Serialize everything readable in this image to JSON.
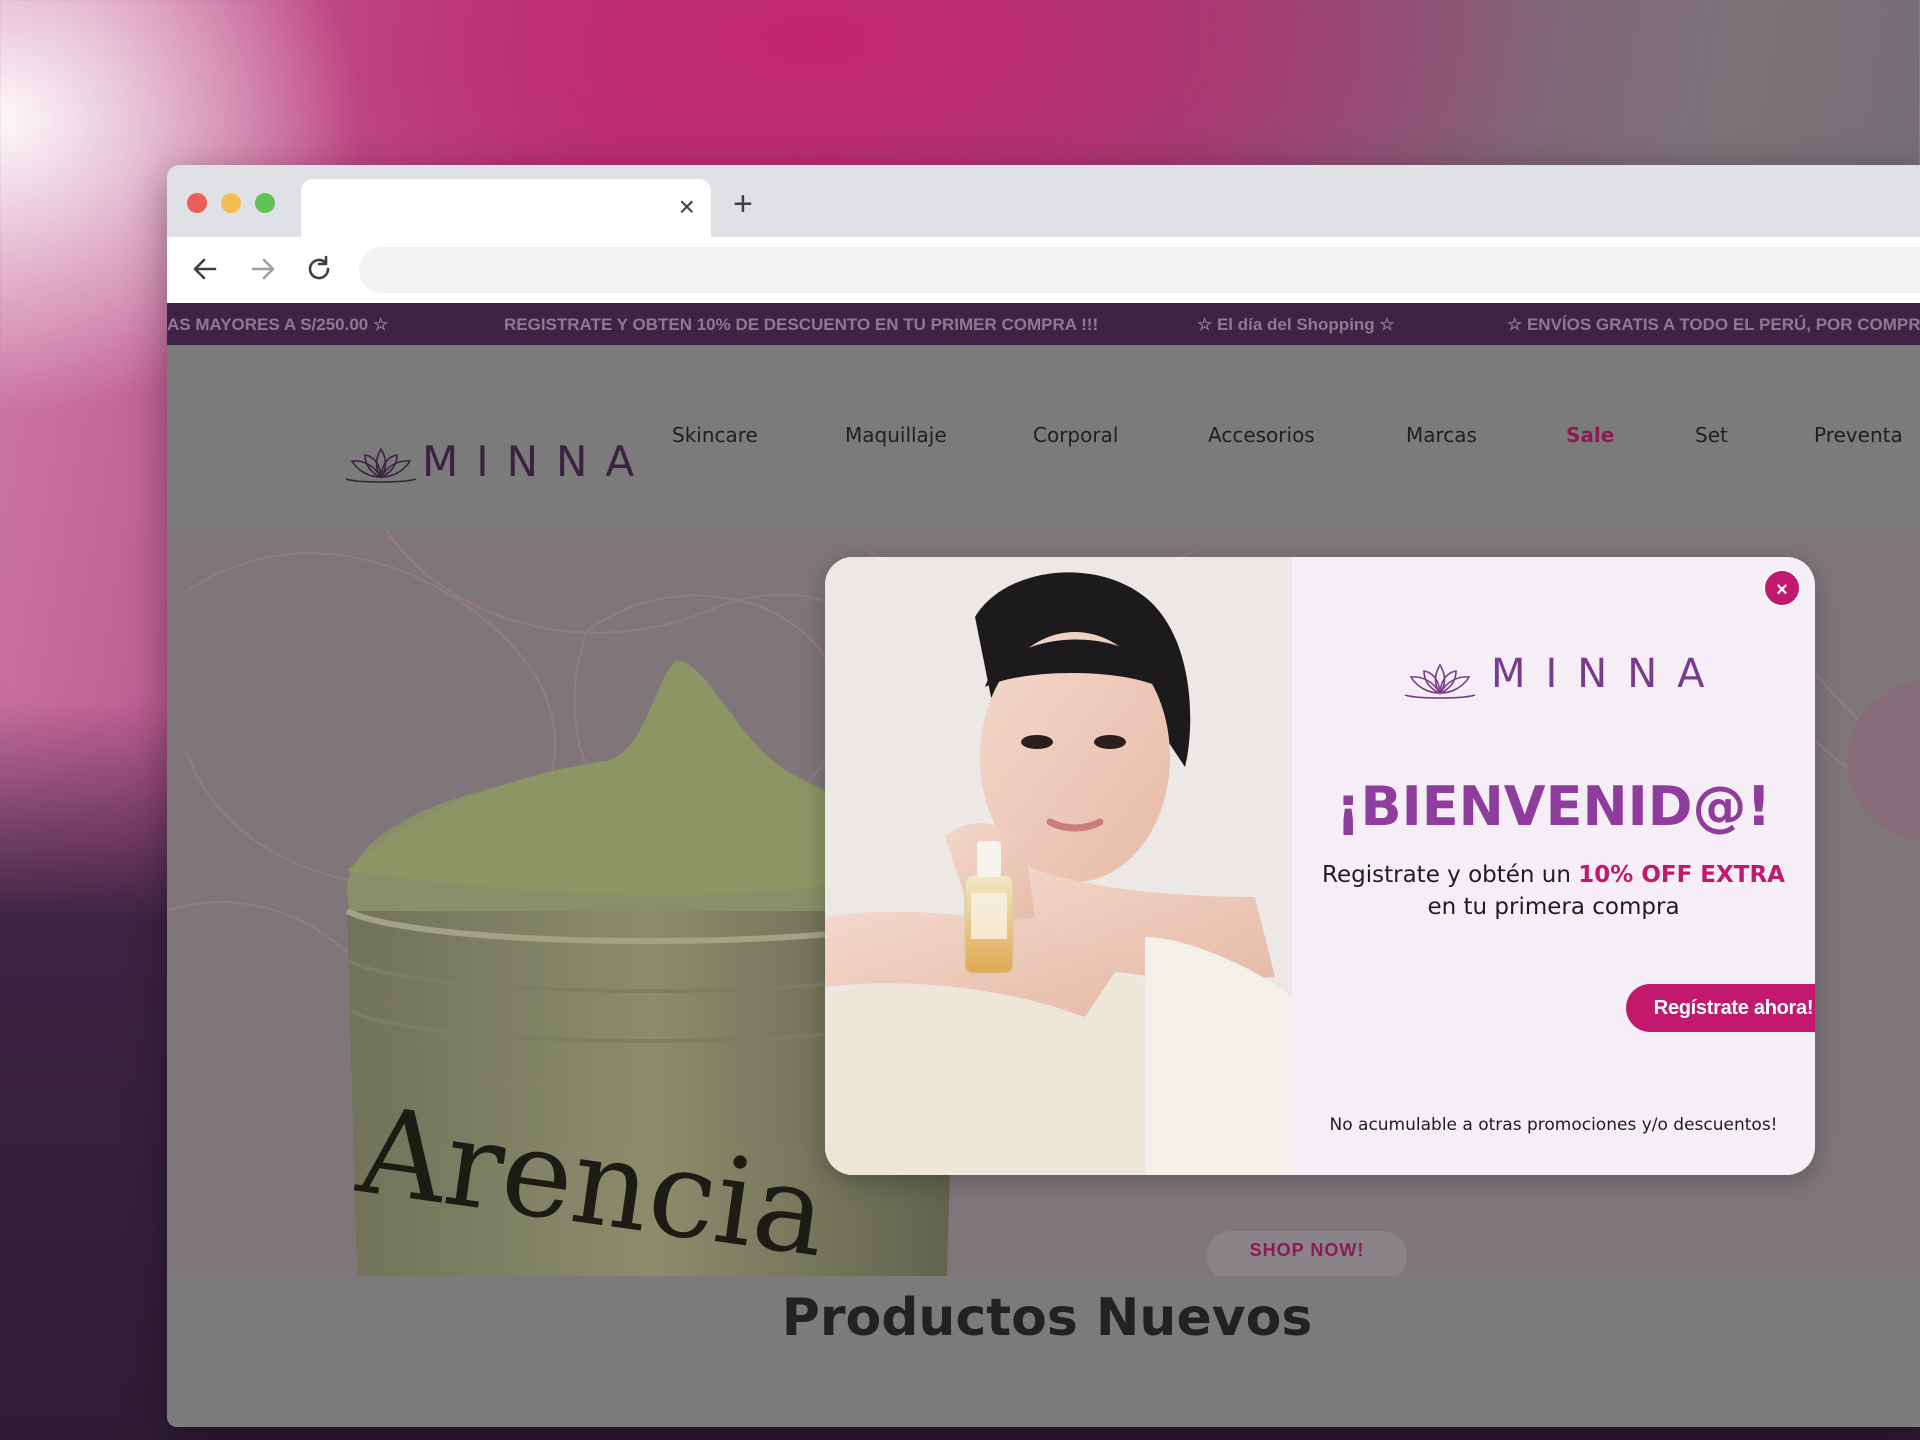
{
  "promo_bar": {
    "items": [
      "AS MAYORES A S/250.00 ☆",
      "REGISTRATE Y OBTEN 10% DE DESCUENTO EN TU PRIMER COMPRA !!!",
      "☆ El día del Shopping ☆",
      "☆ ENVÍOS GRATIS A TODO EL PERÚ, POR COMPRA"
    ]
  },
  "header": {
    "logo_text": "MINNA",
    "nav": [
      "Skincare",
      "Maquillaje",
      "Corporal",
      "Accesorios",
      "Marcas",
      "Sale",
      "Set",
      "Preventa"
    ]
  },
  "hero": {
    "product_text": "Arencia",
    "cta": "SHOP NOW!"
  },
  "section": {
    "title": "Productos Nuevos"
  },
  "modal": {
    "close_label": "×",
    "logo_text": "MINNA",
    "title": "¡BIENVENID@!",
    "copy_before": "Registrate y obtén un ",
    "copy_highlight": "10% OFF EXTRA",
    "copy_line2": "en tu primera compra",
    "cta": "Regístrate ahora!",
    "note": "No acumulable a otras promociones y/o descuentos!"
  },
  "browser": {
    "tab_close": "×",
    "new_tab": "+"
  },
  "colors": {
    "accent": "#c2196e",
    "brand_purple": "#8f3d9c",
    "promo_bg": "#3e2347"
  }
}
